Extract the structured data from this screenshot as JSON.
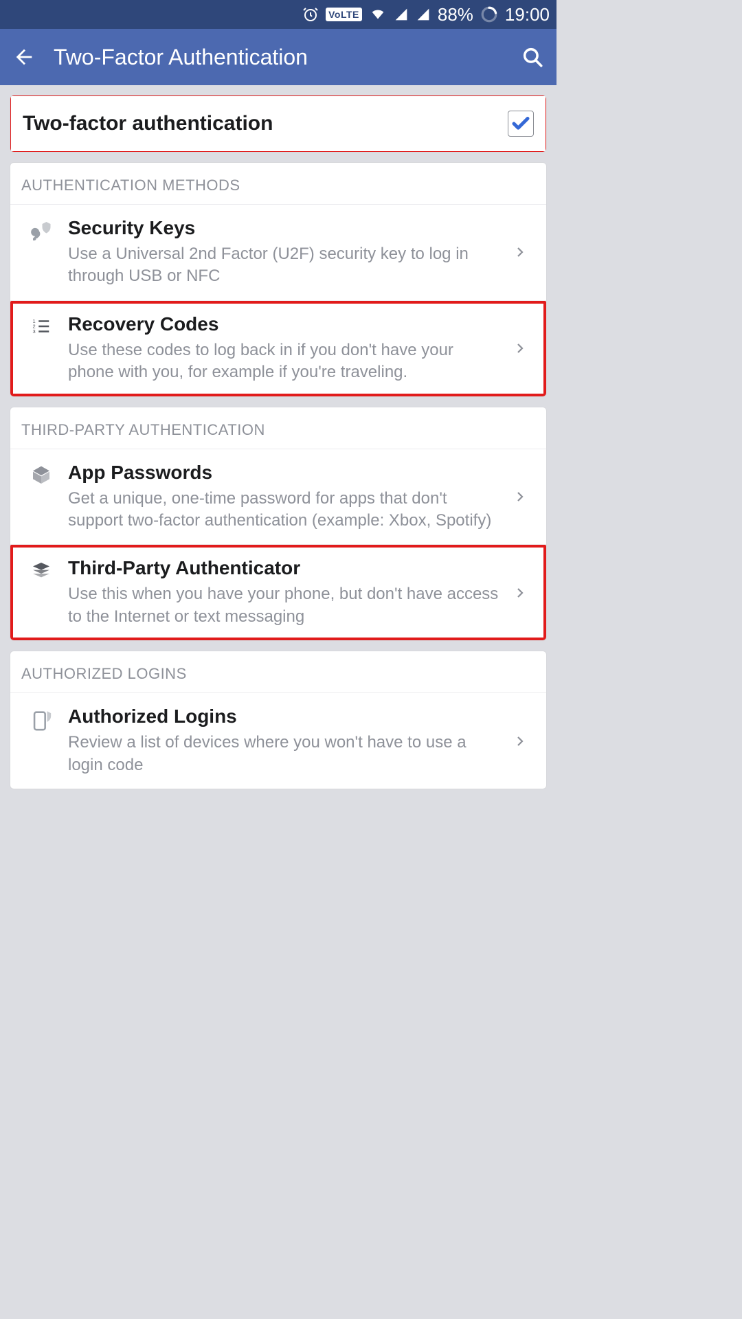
{
  "status": {
    "battery": "88%",
    "time": "19:00",
    "volte": "VoLTE"
  },
  "header": {
    "title": "Two-Factor Authentication"
  },
  "toggle": {
    "label": "Two-factor authentication",
    "checked": true
  },
  "sections": {
    "auth_methods": {
      "header": "AUTHENTICATION METHODS",
      "items": [
        {
          "title": "Security Keys",
          "desc": "Use a Universal 2nd Factor (U2F) security key to log in through USB or NFC"
        },
        {
          "title": "Recovery Codes",
          "desc": "Use these codes to log back in if you don't have your phone with you, for example if you're traveling."
        }
      ]
    },
    "third_party": {
      "header": "THIRD-PARTY AUTHENTICATION",
      "items": [
        {
          "title": "App Passwords",
          "desc": "Get a unique, one-time password for apps that don't support two-factor authentication (example: Xbox, Spotify)"
        },
        {
          "title": "Third-Party Authenticator",
          "desc": "Use this when you have your phone, but don't have access to the Internet or text messaging"
        }
      ]
    },
    "authorized": {
      "header": "AUTHORIZED LOGINS",
      "items": [
        {
          "title": "Authorized Logins",
          "desc": "Review a list of devices where you won't have to use a login code"
        }
      ]
    }
  }
}
